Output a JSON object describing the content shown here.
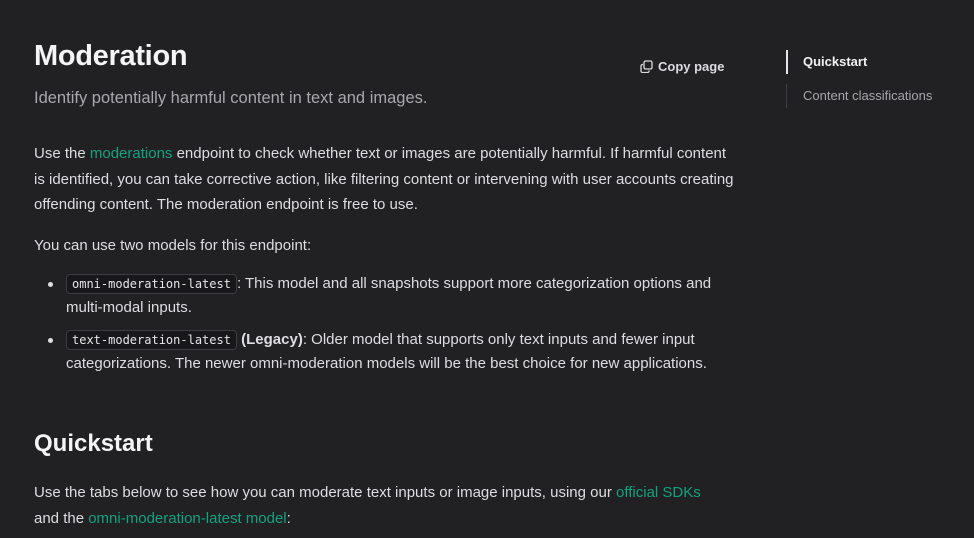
{
  "header": {
    "title": "Moderation",
    "subtitle": "Identify potentially harmful content in text and images.",
    "copy_label": "Copy page"
  },
  "intro": {
    "p1_before": "Use the ",
    "p1_link": "moderations",
    "p1_after": " endpoint to check whether text or images are potentially harmful. If harmful content is identified, you can take corrective action, like filtering content or intervening with user accounts creating offending content. The moderation endpoint is free to use.",
    "p2": "You can use two models for this endpoint:"
  },
  "models": [
    {
      "code": "omni-moderation-latest",
      "bold": "",
      "text": ": This model and all snapshots support more categorization options and multi-modal inputs."
    },
    {
      "code": "text-moderation-latest",
      "bold": "(Legacy)",
      "text": ": Older model that supports only text inputs and fewer input categorizations. The newer omni-moderation models will be the best choice for new applications."
    }
  ],
  "quickstart": {
    "heading": "Quickstart",
    "p_before": "Use the tabs below to see how you can moderate text inputs or image inputs, using our ",
    "link1": "official SDKs",
    "p_mid": " and the ",
    "link2": "omni-moderation-latest model",
    "p_after": ":"
  },
  "toc": {
    "items": [
      {
        "label": "Quickstart",
        "active": true
      },
      {
        "label": "Content classifications",
        "active": false
      }
    ]
  },
  "colors": {
    "background": "#212123",
    "link": "#10a37f",
    "text": "#dedee2",
    "muted": "#a8a8ad"
  }
}
